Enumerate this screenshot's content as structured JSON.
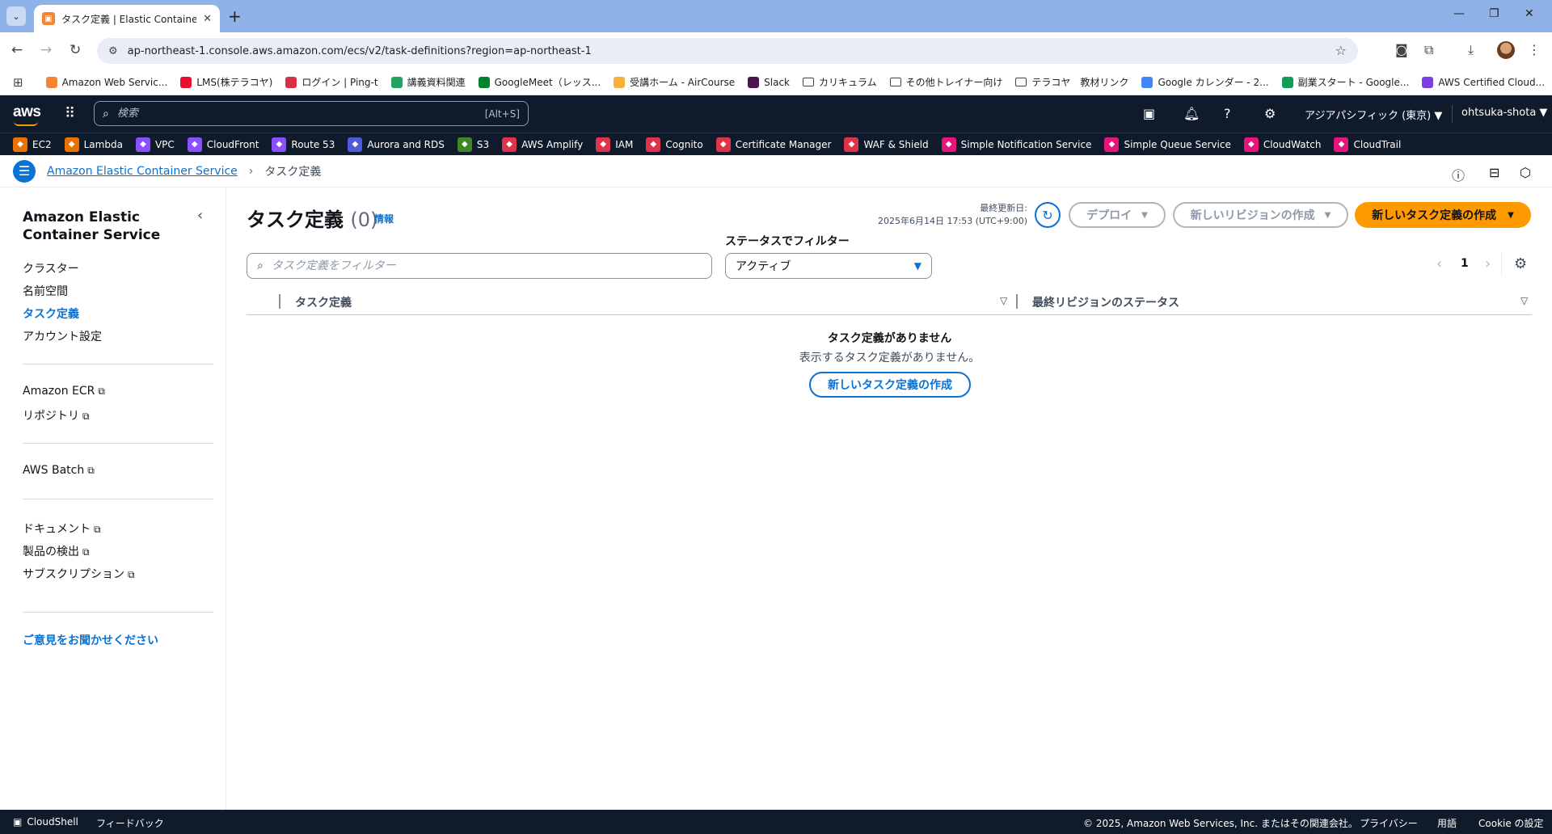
{
  "browser": {
    "tab_title": "タスク定義 | Elastic Container Ser",
    "url": "ap-northeast-1.console.aws.amazon.com/ecs/v2/task-definitions?region=ap-northeast-1",
    "bookmarks": [
      {
        "label": "Amazon Web Servic...",
        "color": "#f58536"
      },
      {
        "label": "LMS(株テラコヤ)",
        "color": "#e8112d"
      },
      {
        "label": "ログイン | Ping-t",
        "color": "#d9304a"
      },
      {
        "label": "講義資料関連",
        "color": "#1fa463"
      },
      {
        "label": "GoogleMeet（レッス...",
        "color": "#00832d"
      },
      {
        "label": "受講ホーム - AirCourse",
        "color": "#f6b13a"
      },
      {
        "label": "Slack",
        "color": "#4a154b"
      },
      {
        "label": "カリキュラム",
        "color": "folder"
      },
      {
        "label": "その他トレイナー向け",
        "color": "folder"
      },
      {
        "label": "テラコヤ　教材リンク",
        "color": "folder"
      },
      {
        "label": "Google カレンダー - 2...",
        "color": "#4285f4"
      },
      {
        "label": "副業スタート - Google...",
        "color": "#0f9d58"
      },
      {
        "label": "AWS Certified Cloud...",
        "color": "#7b3fe4"
      }
    ]
  },
  "aws": {
    "search_placeholder": "検索",
    "search_shortcut": "[Alt+S]",
    "region": "アジアパシフィック (東京)",
    "user": "ohtsuka-shota",
    "favorites": [
      {
        "label": "EC2",
        "color": "#ed7100"
      },
      {
        "label": "Lambda",
        "color": "#ed7100"
      },
      {
        "label": "VPC",
        "color": "#8c4fff"
      },
      {
        "label": "CloudFront",
        "color": "#8c4fff"
      },
      {
        "label": "Route 53",
        "color": "#8c4fff"
      },
      {
        "label": "Aurora and RDS",
        "color": "#4d5bd9"
      },
      {
        "label": "S3",
        "color": "#3f8624"
      },
      {
        "label": "AWS Amplify",
        "color": "#dd344c"
      },
      {
        "label": "IAM",
        "color": "#dd344c"
      },
      {
        "label": "Cognito",
        "color": "#dd344c"
      },
      {
        "label": "Certificate Manager",
        "color": "#dd344c"
      },
      {
        "label": "WAF & Shield",
        "color": "#dd344c"
      },
      {
        "label": "Simple Notification Service",
        "color": "#e7157b"
      },
      {
        "label": "Simple Queue Service",
        "color": "#e7157b"
      },
      {
        "label": "CloudWatch",
        "color": "#e7157b"
      },
      {
        "label": "CloudTrail",
        "color": "#e7157b"
      }
    ],
    "breadcrumb": {
      "service": "Amazon Elastic Container Service",
      "current": "タスク定義"
    }
  },
  "sidenav": {
    "title": "Amazon Elastic Container Service",
    "items": [
      "クラスター",
      "名前空間",
      "タスク定義",
      "アカウント設定"
    ],
    "links1": [
      "Amazon ECR",
      "リポジトリ"
    ],
    "links2": [
      "AWS Batch"
    ],
    "links3": [
      "ドキュメント",
      "製品の検出",
      "サブスクリプション"
    ],
    "feedback": "ご意見をお聞かせください"
  },
  "main": {
    "title": "タスク定義",
    "count": "(0)",
    "info": "情報",
    "last_updated_label": "最終更新日:",
    "last_updated_value": "2025年6月14日 17:53 (UTC+9:00)",
    "deploy": "デプロイ",
    "new_revision": "新しいリビジョンの作成",
    "create": "新しいタスク定義の作成",
    "filter_label": "ステータスでフィルター",
    "filter_placeholder": "タスク定義をフィルター",
    "status_value": "アクティブ",
    "page": "1",
    "columns": [
      "タスク定義",
      "最終リビジョンのステータス"
    ],
    "empty_title": "タスク定義がありません",
    "empty_sub": "表示するタスク定義がありません。",
    "empty_button": "新しいタスク定義の作成"
  },
  "footer": {
    "cloudshell": "CloudShell",
    "feedback": "フィードバック",
    "copyright": "© 2025, Amazon Web Services, Inc. またはその関連会社。",
    "privacy": "プライバシー",
    "terms": "用語",
    "cookie": "Cookie の設定"
  }
}
